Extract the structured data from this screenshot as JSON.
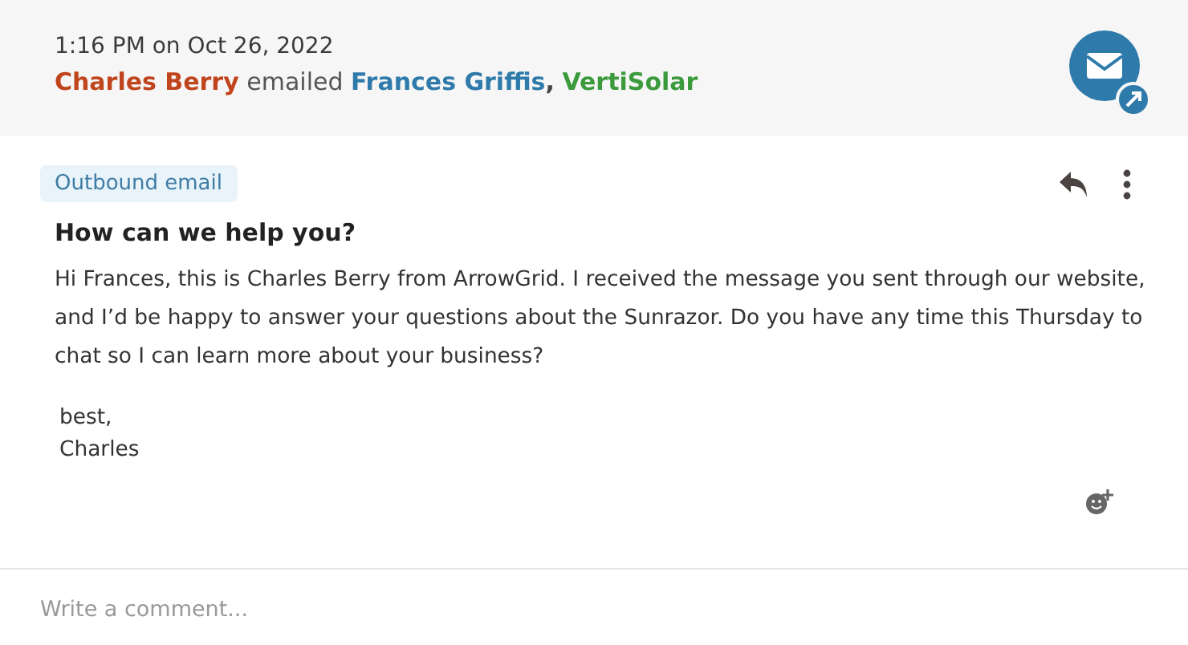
{
  "header": {
    "timestamp": "1:16 PM on Oct 26, 2022",
    "sender": {
      "name": "Charles Berry",
      "color": "#c0441c"
    },
    "verb": "emailed",
    "separator": ",",
    "recipients": [
      {
        "name": "Frances Griffis",
        "color": "#2e7aaa"
      },
      {
        "name": "VertiSolar",
        "color": "#3a9a3c"
      }
    ]
  },
  "email": {
    "tag": "Outbound email",
    "subject": "How can we help you?",
    "body": [
      "Hi Frances, this is Charles Berry from ArrowGrid. I received the message you sent through our website, and I’d be happy to answer your questions about the Sunrazor. Do you have any time this Thursday to chat so I can learn more about your business?"
    ],
    "signature": [
      "best,",
      "Charles"
    ]
  },
  "comment": {
    "placeholder": "Write a comment..."
  }
}
